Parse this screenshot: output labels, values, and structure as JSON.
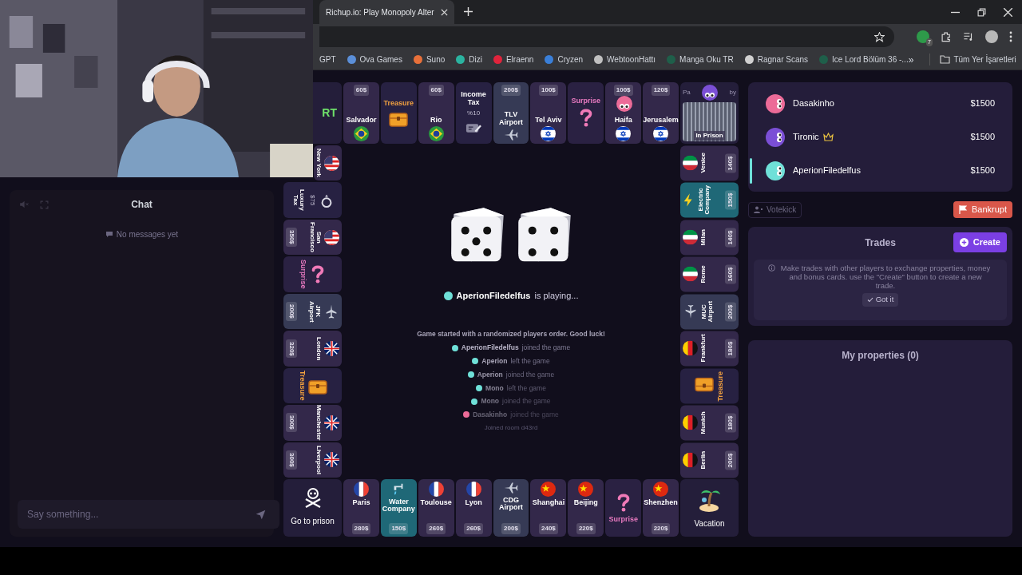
{
  "browser": {
    "tab_title": "Richup.io: Play Monopoly Alter",
    "extension_badge": "7",
    "bookmarks": [
      {
        "label": "GPT"
      },
      {
        "label": "Ova Games",
        "color": "#5b8fd8"
      },
      {
        "label": "Suno",
        "color": "#e8703a"
      },
      {
        "label": "Dizi",
        "color": "#2bb3a0"
      },
      {
        "label": "Elraenn",
        "color": "#e0243c"
      },
      {
        "label": "Cryzen",
        "color": "#3a7fd8"
      },
      {
        "label": "WebtoonHattı",
        "color": "#c0c0c0"
      },
      {
        "label": "Manga Oku TR",
        "color": "#1f5f4a"
      },
      {
        "label": "Ragnar Scans",
        "color": "#d0d0d0"
      },
      {
        "label": "Ice Lord Bölüm 36 -...",
        "color": "#1f5f4a"
      }
    ],
    "bookmarks_more": "»",
    "all_bookmarks": "Tüm Yer İşaretleri"
  },
  "chat": {
    "title": "Chat",
    "empty": "No messages yet",
    "placeholder": "Say something..."
  },
  "board": {
    "corner_top_left": "RT",
    "top": [
      {
        "kind": "city",
        "name": "Salvador",
        "price": "60$",
        "color": "#2a9a3e"
      },
      {
        "kind": "treasure",
        "name": "Treasure"
      },
      {
        "kind": "city",
        "name": "Rio",
        "price": "60$",
        "color": "#2a9a3e"
      },
      {
        "kind": "tax",
        "name": "Income Tax",
        "sub": "%10"
      },
      {
        "kind": "airport",
        "name": "TLV Airport",
        "price": "200$"
      },
      {
        "kind": "city",
        "name": "Tel Aviv",
        "price": "100$",
        "color": "#0038b8"
      },
      {
        "kind": "surprise",
        "name": "Surprise"
      },
      {
        "kind": "city",
        "name": "Haifa",
        "price": "100$",
        "color": "#0038b8",
        "token": {
          "color": "#ec6b98"
        }
      },
      {
        "kind": "city",
        "name": "Jerusalem",
        "price": "120$",
        "color": "#0038b8"
      }
    ],
    "corner_top_right": {
      "label_start": "Pa",
      "label_end": "by",
      "prison": "In Prison",
      "token": {
        "color": "#7b4fd6"
      }
    },
    "left": [
      {
        "kind": "city",
        "name": "New York",
        "color": "#3c3b6e"
      },
      {
        "kind": "tax",
        "name": "Luxury Tax",
        "sub": "$75"
      },
      {
        "kind": "city",
        "name": "San Francisco",
        "price": "350$",
        "color": "#3c3b6e"
      },
      {
        "kind": "surprise",
        "name": "Surprise"
      },
      {
        "kind": "airport",
        "name": "JFK Airport",
        "price": "200$"
      },
      {
        "kind": "city",
        "name": "London",
        "price": "320$",
        "color": "#012169"
      },
      {
        "kind": "treasure",
        "name": "Treasure"
      },
      {
        "kind": "city",
        "name": "Manchester",
        "price": "300$",
        "color": "#012169"
      },
      {
        "kind": "city",
        "name": "Liverpool",
        "price": "300$",
        "color": "#012169"
      }
    ],
    "right": [
      {
        "kind": "city",
        "name": "Venice",
        "price": "140$",
        "color": "#009246"
      },
      {
        "kind": "utility",
        "name": "Electric Company",
        "price": "150$"
      },
      {
        "kind": "city",
        "name": "Milan",
        "price": "140$",
        "color": "#009246"
      },
      {
        "kind": "city",
        "name": "Rome",
        "price": "160$",
        "color": "#009246"
      },
      {
        "kind": "airport",
        "name": "MUC Airport",
        "price": "200$"
      },
      {
        "kind": "city",
        "name": "Frankfurt",
        "price": "180$",
        "color": "#ffce00"
      },
      {
        "kind": "treasure",
        "name": "Treasure"
      },
      {
        "kind": "city",
        "name": "Munich",
        "price": "180$",
        "color": "#ffce00"
      },
      {
        "kind": "city",
        "name": "Berlin",
        "price": "200$",
        "color": "#ffce00"
      }
    ],
    "corner_bottom_left": "Go to prison",
    "bottom": [
      {
        "kind": "city",
        "name": "Paris",
        "price": "280$",
        "color": "#ef4135"
      },
      {
        "kind": "utility",
        "name": "Water Company",
        "price": "150$"
      },
      {
        "kind": "city",
        "name": "Toulouse",
        "price": "260$",
        "color": "#ef4135"
      },
      {
        "kind": "city",
        "name": "Lyon",
        "price": "260$",
        "color": "#ef4135"
      },
      {
        "kind": "airport",
        "name": "CDG Airport",
        "price": "200$"
      },
      {
        "kind": "city",
        "name": "Shanghai",
        "price": "240$",
        "color": "#de2910"
      },
      {
        "kind": "city",
        "name": "Beijing",
        "price": "220$",
        "color": "#de2910"
      },
      {
        "kind": "surprise",
        "name": "Surprise"
      },
      {
        "kind": "city",
        "name": "Shenzhen",
        "price": "220$",
        "color": "#de2910"
      }
    ],
    "corner_bottom_right": "Vacation"
  },
  "game": {
    "current_player": {
      "name": "AperionFiledelfus",
      "color": "#6fe0d8"
    },
    "status": "is playing...",
    "log": [
      {
        "kind": "system",
        "text": "Game started with a randomized players order. Good luck!"
      },
      {
        "kind": "event",
        "name": "AperionFiledelfus",
        "action": "joined the game",
        "color": "#6fe0d8"
      },
      {
        "kind": "event",
        "name": "Aperion",
        "action": "left the game",
        "color": "#6fe0d8"
      },
      {
        "kind": "event",
        "name": "Aperion",
        "action": "joined the game",
        "color": "#6fe0d8"
      },
      {
        "kind": "event",
        "name": "Mono",
        "action": "left the game",
        "color": "#6fe0d8"
      },
      {
        "kind": "event",
        "name": "Mono",
        "action": "joined the game",
        "color": "#6fe0d8"
      },
      {
        "kind": "event",
        "name": "Dasakinho",
        "action": "joined the game",
        "color": "#ec6b98"
      },
      {
        "kind": "room",
        "text": "Joined room d43rd"
      }
    ]
  },
  "players": [
    {
      "name": "Dasakinho",
      "money": "$1500",
      "color": "#ec6b98",
      "host": false,
      "current": false
    },
    {
      "name": "Tironic",
      "money": "$1500",
      "color": "#7b4fd6",
      "host": true,
      "current": false
    },
    {
      "name": "AperionFiledelfus",
      "money": "$1500",
      "color": "#6fe0d8",
      "host": false,
      "current": true
    }
  ],
  "actions": {
    "votekick": "Votekick",
    "bankrupt": "Bankrupt"
  },
  "trades": {
    "title": "Trades",
    "create": "Create",
    "info": "Make trades with other players to exchange properties, money and bonus cards. use the \"Create\" button to create a new trade.",
    "got_it": "Got it"
  },
  "properties": {
    "title": "My properties (0)"
  }
}
